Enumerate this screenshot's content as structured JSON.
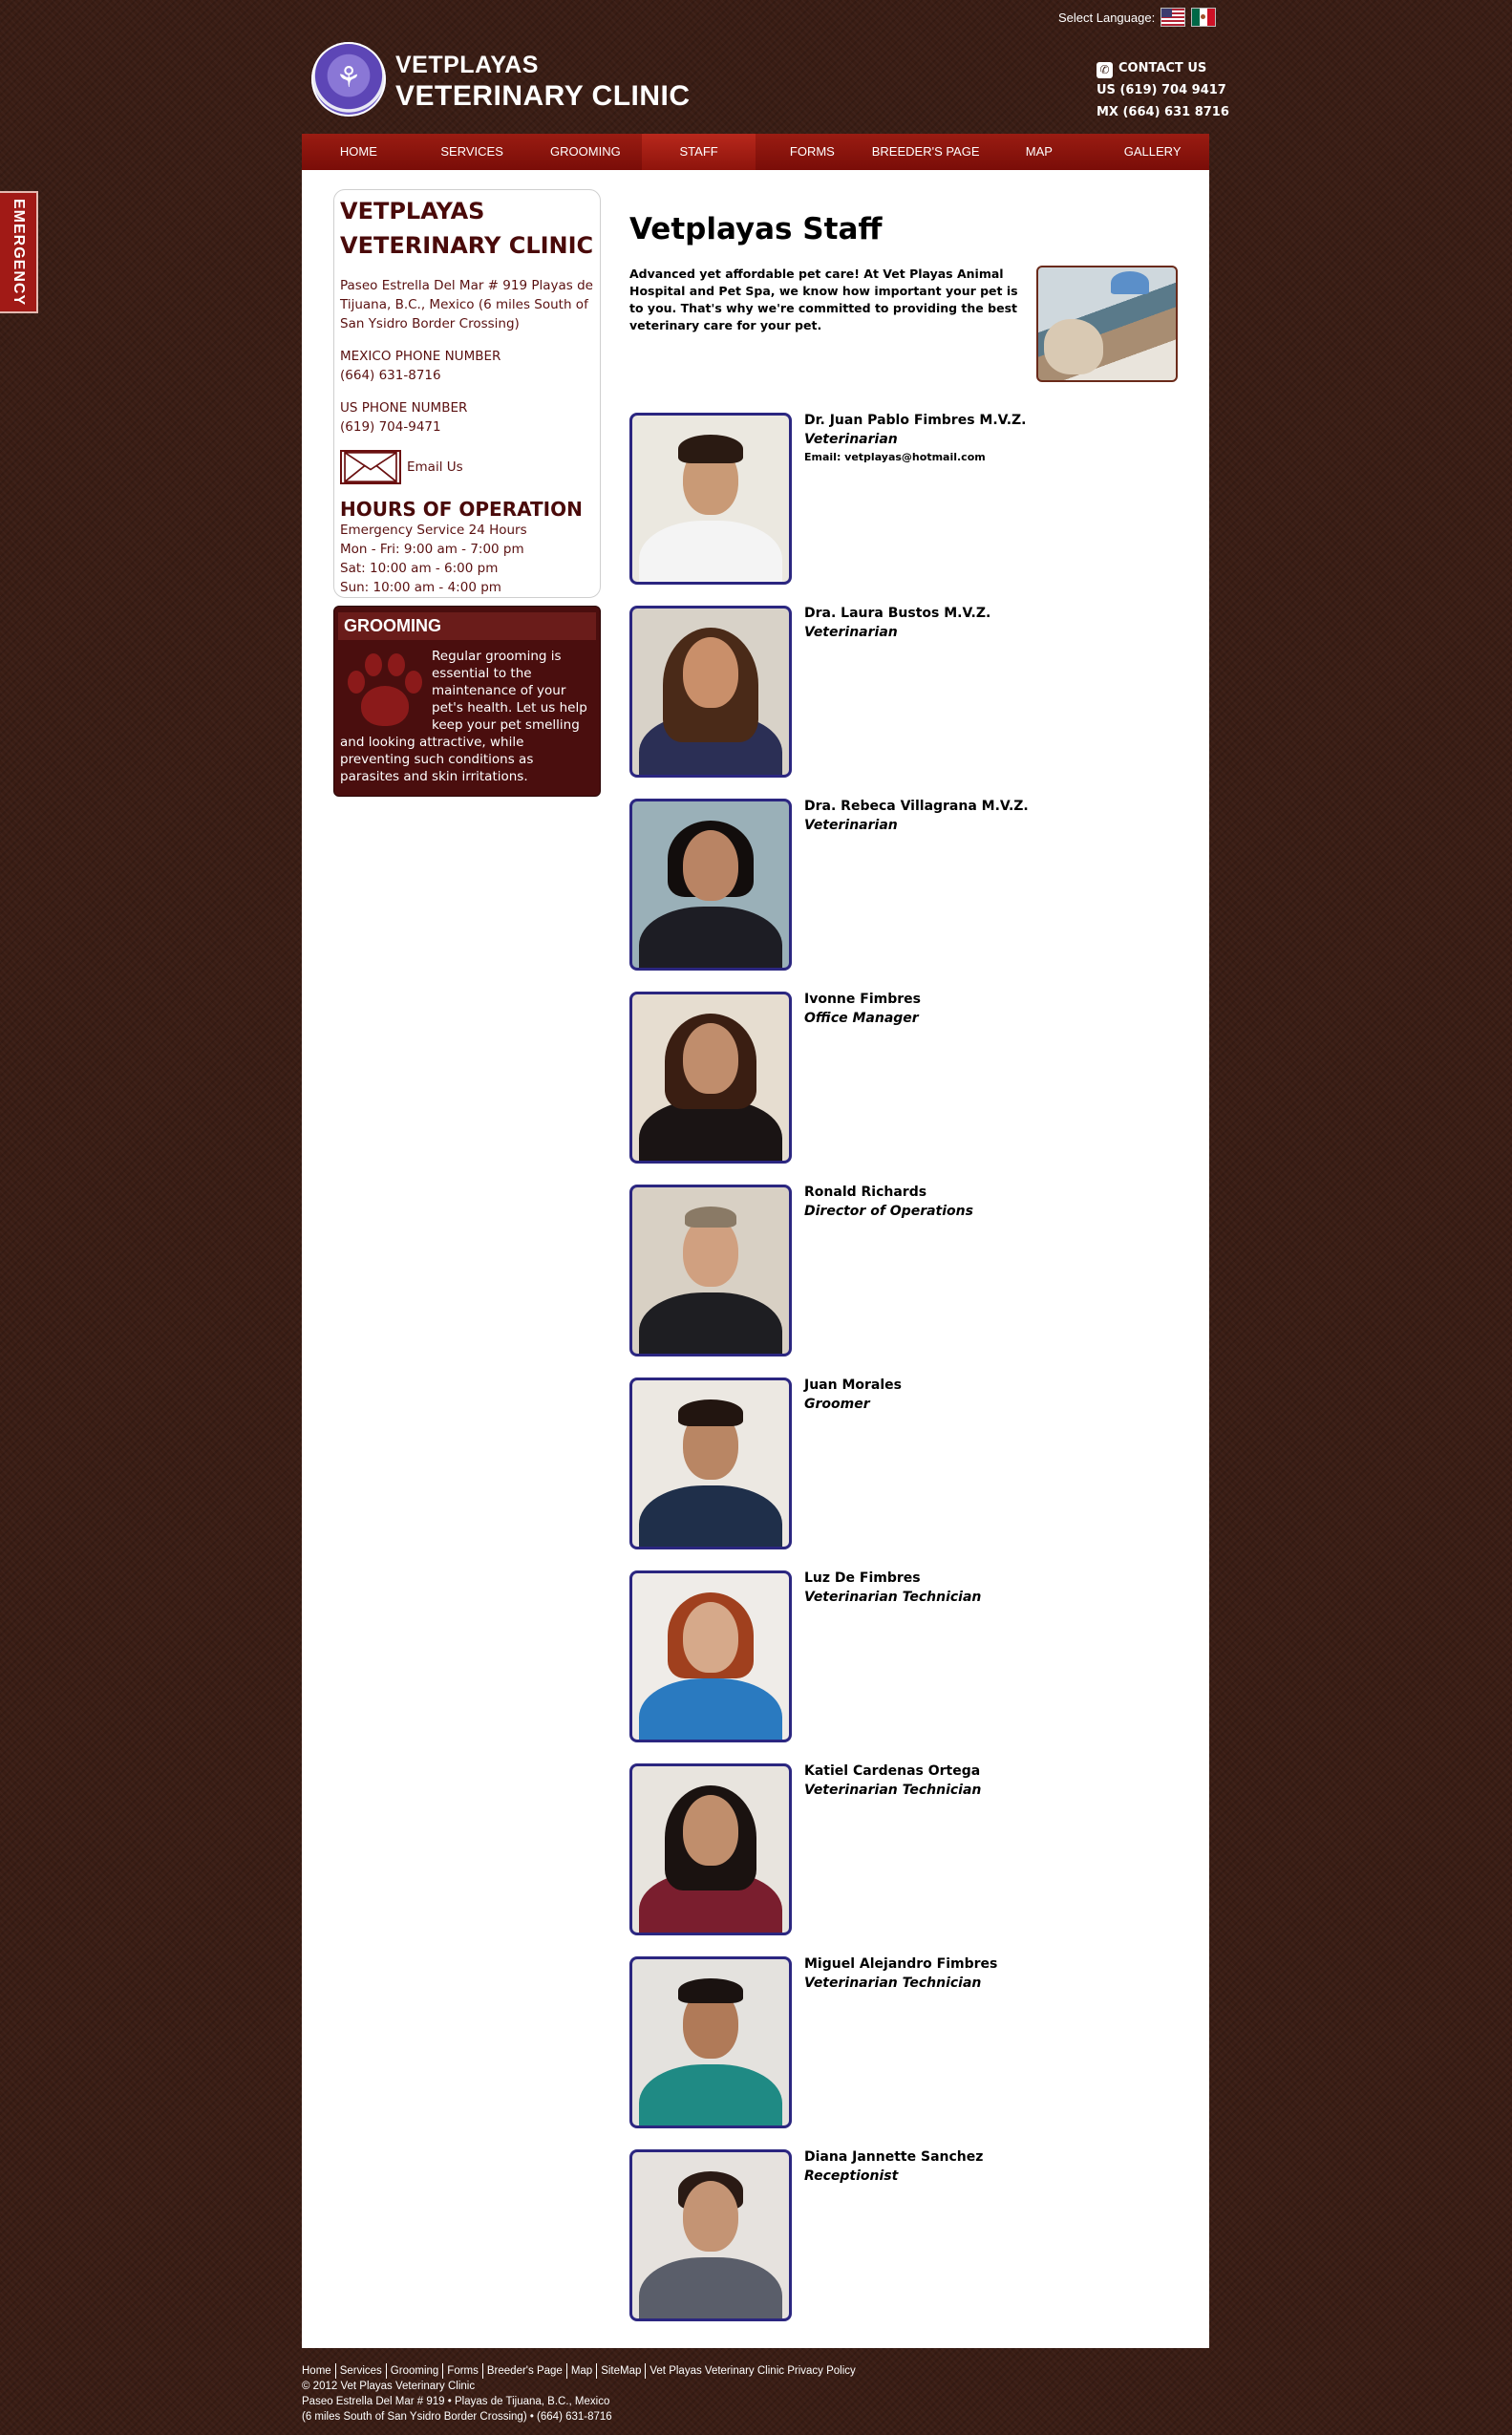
{
  "header": {
    "language_label": "Select Language:",
    "brand_line1": "VETPLAYAS",
    "brand_line2": "VETERINARY CLINIC",
    "contact_label": "CONTACT US",
    "us_phone": "US (619) 704 9417",
    "mx_phone": "MX (664) 631 8716",
    "languages": [
      {
        "name": "English",
        "icon": "us-flag-icon"
      },
      {
        "name": "Spanish",
        "icon": "mexico-flag-icon"
      }
    ]
  },
  "nav": {
    "active": "STAFF",
    "items": [
      "HOME",
      "SERVICES",
      "GROOMING",
      "STAFF",
      "FORMS",
      "BREEDER'S PAGE",
      "MAP",
      "GALLERY"
    ]
  },
  "emergency_tab": "EMERGENCY",
  "sidebar": {
    "title": "VETPLAYAS VETERINARY CLINIC",
    "address": "Paseo Estrella Del Mar # 919 Playas de Tijuana, B.C., Mexico (6 miles South of San Ysidro Border Crossing)",
    "mexico_phone_label": "MEXICO PHONE NUMBER",
    "mexico_phone": "(664) 631-8716",
    "us_phone_label": "US PHONE NUMBER",
    "us_phone": "(619) 704-9471",
    "email_label": "Email Us",
    "hours_title": "HOURS OF OPERATION",
    "hours": [
      "Emergency Service 24 Hours",
      "Mon - Fri: 9:00 am - 7:00 pm",
      "Sat: 10:00 am - 6:00 pm",
      "Sun: 10:00 am - 4:00 pm"
    ],
    "grooming_title": "GROOMING",
    "grooming_text": "Regular grooming is essential to the maintenance of your pet's health. Let us help keep your pet smelling and looking attractive, while preventing such conditions as parasites and skin irritations."
  },
  "main": {
    "title": "Vetplayas Staff",
    "intro": "Advanced yet affordable pet care! At Vet Playas Animal Hospital and Pet Spa, we know how important your pet is to you. That's why we're committed to providing the best veterinary care for your pet.",
    "staff": [
      {
        "name": "Dr. Juan Pablo Fimbres M.V.Z.",
        "role": "Veterinarian",
        "email": "Email: vetplayas@hotmail.com"
      },
      {
        "name": "Dra. Laura Bustos M.V.Z.",
        "role": "Veterinarian"
      },
      {
        "name": "Dra. Rebeca Villagrana M.V.Z.",
        "role": "Veterinarian"
      },
      {
        "name": "Ivonne Fimbres",
        "role": "Office Manager"
      },
      {
        "name": "Ronald Richards",
        "role": "Director of Operations"
      },
      {
        "name": "Juan Morales",
        "role": "Groomer"
      },
      {
        "name": "Luz De Fimbres",
        "role": "Veterinarian Technician"
      },
      {
        "name": "Katiel Cardenas Ortega",
        "role": "Veterinarian Technician"
      },
      {
        "name": "Miguel Alejandro Fimbres",
        "role": "Veterinarian Technician"
      },
      {
        "name": "Diana Jannette Sanchez",
        "role": "Receptionist"
      }
    ]
  },
  "footer": {
    "links": [
      "Home",
      "Services",
      "Grooming",
      "Forms",
      "Breeder's Page",
      "Map",
      "SiteMap",
      "Vet Playas Veterinary Clinic Privacy Policy"
    ],
    "copyright": "© 2012 Vet Playas Veterinary Clinic",
    "address_line1": "Paseo Estrella Del Mar # 919 • Playas de Tijuana, B.C., Mexico",
    "address_line2": "(6 miles South of San Ysidro Border Crossing) • (664) 631-8716"
  }
}
